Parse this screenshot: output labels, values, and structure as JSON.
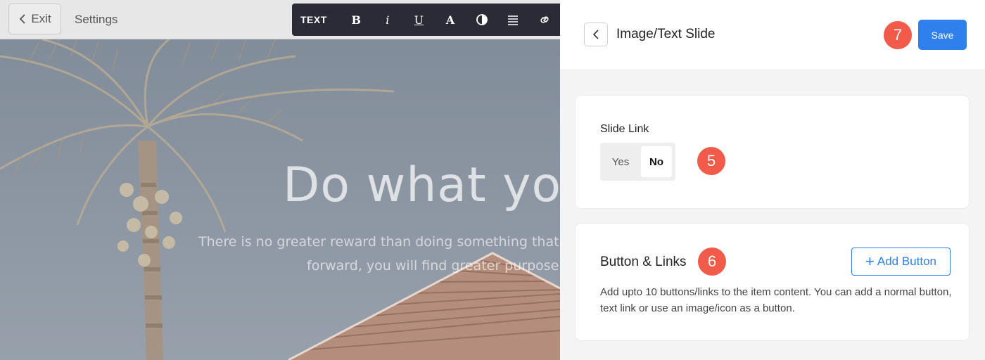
{
  "topbar": {
    "exit_label": "Exit",
    "settings_label": "Settings"
  },
  "text_toolbar": {
    "label": "TEXT",
    "bold": "B",
    "italic": "i",
    "underline": "U",
    "font": "A"
  },
  "hero": {
    "title": "Do what yo",
    "subtitle_line1": "There is no greater reward than doing something that yo",
    "subtitle_line2": "forward, you will find greater purpose a"
  },
  "panel": {
    "title": "Image/Text Slide",
    "save_label": "Save",
    "step_save": "7",
    "slide_link": {
      "label": "Slide Link",
      "yes": "Yes",
      "no": "No",
      "selected": "No",
      "step": "5"
    },
    "buttons_links": {
      "title": "Button & Links",
      "step": "6",
      "add_button": "Add Button",
      "description": "Add upto 10 buttons/links to the item content. You can add a normal button, text link or use an image/icon as a button."
    }
  },
  "colors": {
    "accent": "#2f80ed",
    "badge": "#f25a49",
    "toolbar": "#2b2b38"
  }
}
